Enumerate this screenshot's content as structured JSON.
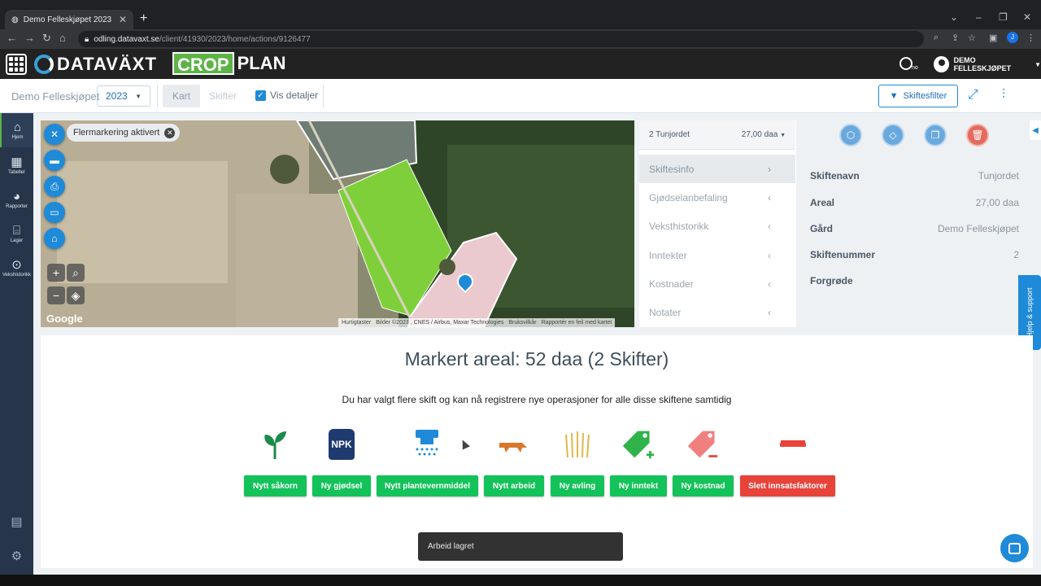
{
  "browser": {
    "tab_title": "Demo Felleskjøpet 2023",
    "url_host": "odling.datavaxt.se",
    "url_path": "/client/41930/2023/home/actions/9126477"
  },
  "header": {
    "brand": "DATAVÄXT",
    "crop": "CROP",
    "plan": "PLAN",
    "lang": "no",
    "user": "DEMO FELLESKJØPET"
  },
  "subheader": {
    "farm": "Demo Felleskjøpet",
    "year": "2023",
    "view_map": "Kart",
    "view_fields": "Skifter",
    "show_details": "Vis detaljer",
    "filter_button": "Skiftesfilter"
  },
  "sidebar": [
    {
      "label": "Hjem",
      "icon": "home-icon"
    },
    {
      "label": "Tabeller",
      "icon": "table-icon"
    },
    {
      "label": "Rapporter",
      "icon": "pie-chart-icon"
    },
    {
      "label": "Lager",
      "icon": "warehouse-icon"
    },
    {
      "label": "Vekshistorikk",
      "icon": "seedling-icon"
    }
  ],
  "map": {
    "multimark_label": "Flermarkering aktivert",
    "google": "Google",
    "attribution": {
      "shortcuts": "Hurtigtaster",
      "imagery": "Bilder ©2023 , CNES / Airbus, Maxar Technologies",
      "terms": "Bruksvilkår",
      "report": "Rapportér en feil med kartet"
    }
  },
  "field_panel": {
    "selected_field": "2 Tunjordet",
    "selected_area": "27,00 daa",
    "menu": [
      "Skiftesinfo",
      "Gjødselanbefaling",
      "Veksthistorikk",
      "Inntekter",
      "Kostnader",
      "Notater"
    ],
    "details": [
      {
        "label": "Skiftenavn",
        "value": "Tunjordet"
      },
      {
        "label": "Areal",
        "value": "27,00 daa"
      },
      {
        "label": "Gård",
        "value": "Demo Felleskjøpet"
      },
      {
        "label": "Skiftenummer",
        "value": "2"
      },
      {
        "label": "Forgrøde",
        "value": ""
      }
    ]
  },
  "help_tab": "Hjelp & support",
  "main": {
    "title": "Markert areal: 52 daa (2 Skifter)",
    "subtitle": "Du har valgt flere skift og kan nå registrere nye operasjoner for alle disse skiftene samtidig",
    "npk": "NPK",
    "operations": [
      {
        "label": "Nytt såkorn",
        "icon": "sprout-icon"
      },
      {
        "label": "Ny gjødsel",
        "icon": "fertilizer-bag-icon"
      },
      {
        "label": "Nytt plantevernmiddel",
        "icon": "sprayer-icon"
      },
      {
        "label": "Nytt arbeid",
        "icon": "plough-icon"
      },
      {
        "label": "Ny avling",
        "icon": "wheat-icon"
      },
      {
        "label": "Ny inntekt",
        "icon": "tag-plus-icon"
      },
      {
        "label": "Ny kostnad",
        "icon": "tag-minus-icon"
      },
      {
        "label": "Slett innsatsfaktorer",
        "icon": "delete-bar-icon"
      }
    ]
  },
  "toast": "Arbeid lagret",
  "colors": {
    "primary_blue": "#1f8ad8",
    "action_green": "#14c25a",
    "danger_red": "#e8433b",
    "sidebar_navy": "#26354a"
  }
}
